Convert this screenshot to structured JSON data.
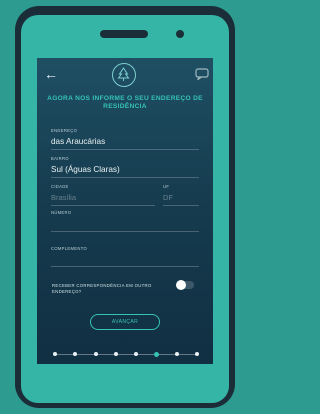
{
  "header": {
    "title": "AGORA NOS INFORME O SEU ENDEREÇO DE RESIDÊNCIA"
  },
  "icons": {
    "back": "back-arrow-icon",
    "logo": "tree-logo-icon",
    "chat": "chat-icon"
  },
  "form": {
    "street": {
      "label": "ENDEREÇO",
      "value": "das Araucárias"
    },
    "neighborhood": {
      "label": "BAIRRO",
      "value": "Sul (Águas Claras)"
    },
    "city": {
      "label": "CIDADE",
      "value": "Brasília"
    },
    "state": {
      "label": "UF",
      "value": "DF"
    },
    "number": {
      "label": "NÚMERO",
      "value": ""
    },
    "complement": {
      "label": "COMPLEMENTO",
      "value": ""
    }
  },
  "option": {
    "label": "RECEBER CORRESPONDÊNCIA EM OUTRO ENDEREÇO?",
    "enabled": false
  },
  "actions": {
    "continue_label": "AVANÇAR"
  },
  "progress": {
    "total_steps": 8,
    "current_step": 6
  },
  "colors": {
    "background": "#2d9b8f",
    "phone_body": "#1a2d38",
    "accent": "#35c3b3",
    "screen": "#163c4f"
  }
}
